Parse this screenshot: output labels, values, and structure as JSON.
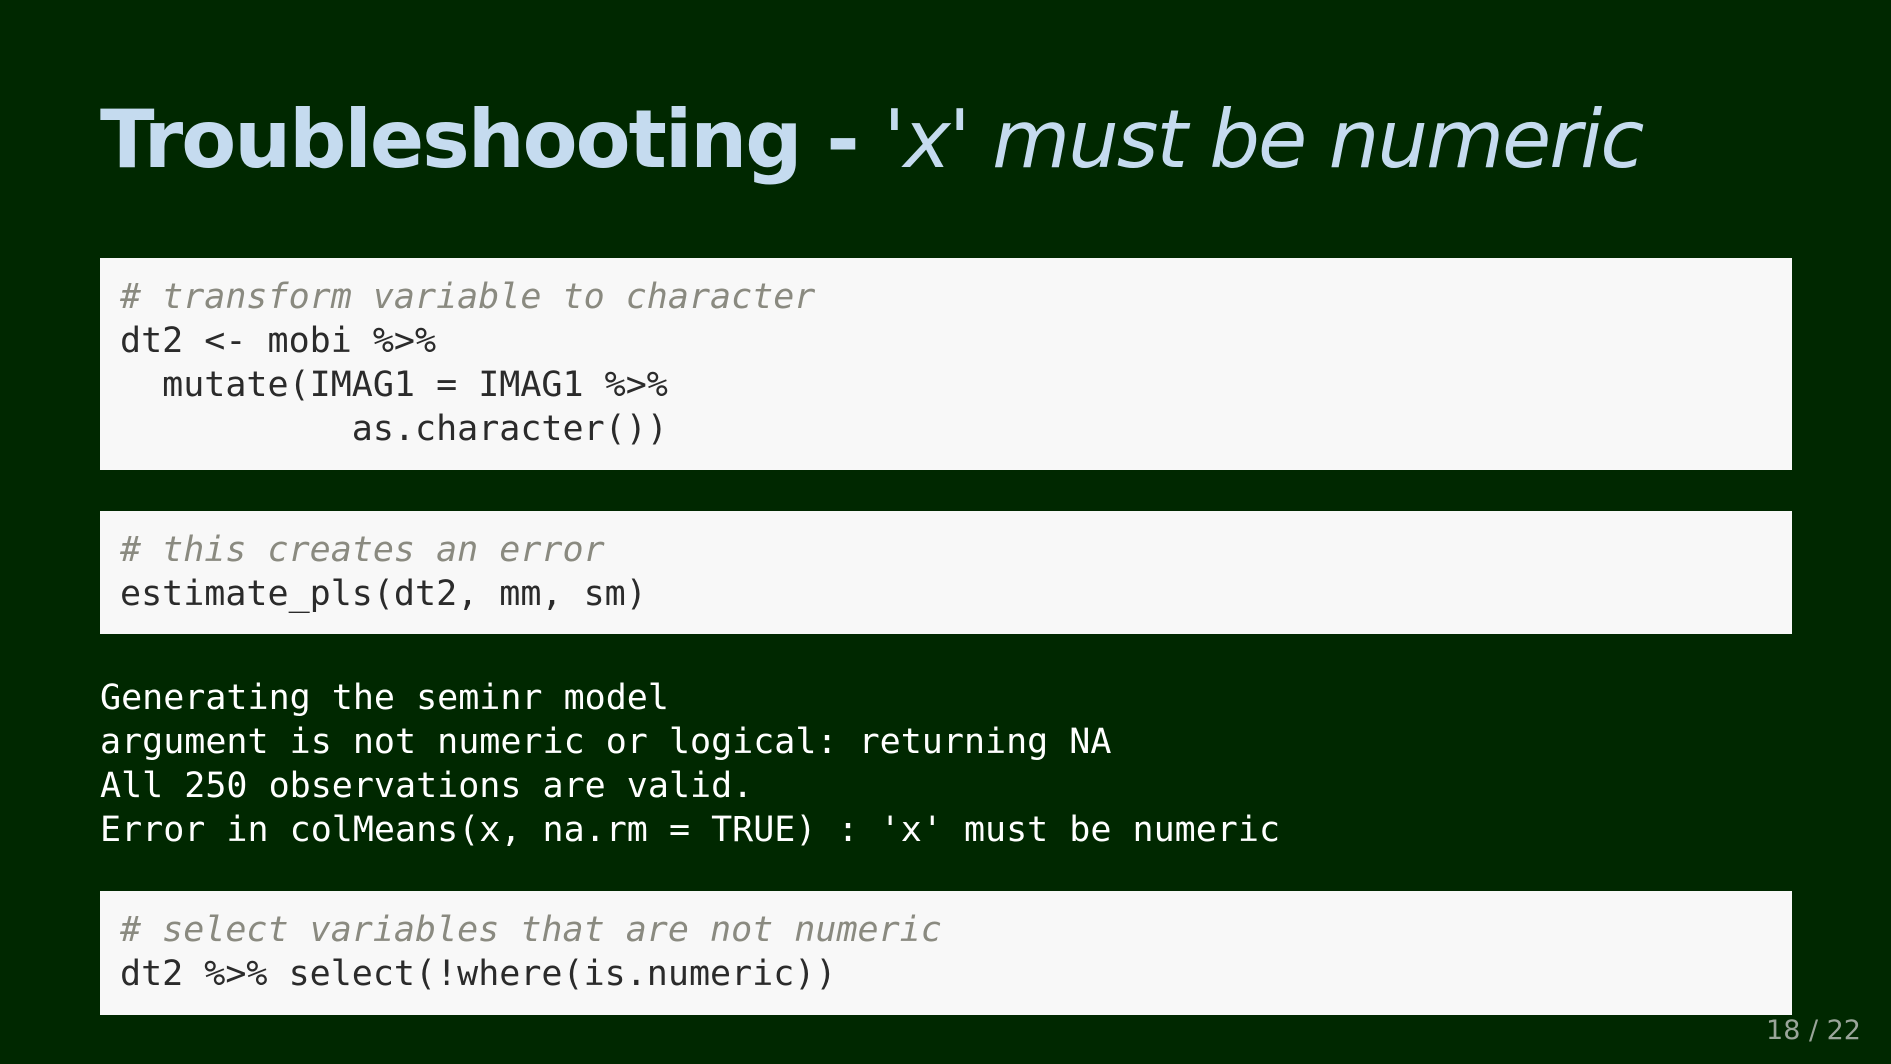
{
  "slide": {
    "title_main": "Troubleshooting - ",
    "title_emph": "'x' must be numeric",
    "page_number": "18 / 22"
  },
  "code_blocks": [
    {
      "lines": [
        "# transform variable to character",
        "dt2 <- mobi %>%",
        "  mutate(IMAG1 = IMAG1 %>%",
        "           as.character())"
      ]
    },
    {
      "lines": [
        "# this creates an error",
        "estimate_pls(dt2, mm, sm)"
      ]
    },
    {
      "lines": [
        "# select variables that are not numeric",
        "dt2 %>% select(!where(is.numeric))"
      ]
    }
  ],
  "console_output": {
    "lines": [
      "Generating the seminr model",
      "argument is not numeric or logical: returning NA",
      "All 250 observations are valid.",
      "Error in colMeans(x, na.rm = TRUE) : 'x' must be numeric"
    ]
  },
  "colors": {
    "background": "#002800",
    "title": "#c5dbef",
    "code_background": "#f8f8f8",
    "code_text": "#2b2b2b",
    "code_comment": "#8a8a80",
    "console_text": "#ffffff"
  }
}
